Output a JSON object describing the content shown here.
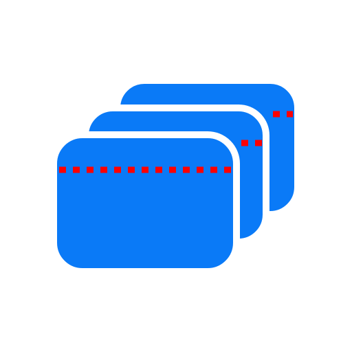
{
  "icon": {
    "name": "stacked-cards-icon",
    "card_count": 3,
    "colors": {
      "card_fill": "#0a7af7",
      "card_stroke": "#ffffff",
      "separator_dots": "#ff0000",
      "background": "#ffffff"
    }
  }
}
